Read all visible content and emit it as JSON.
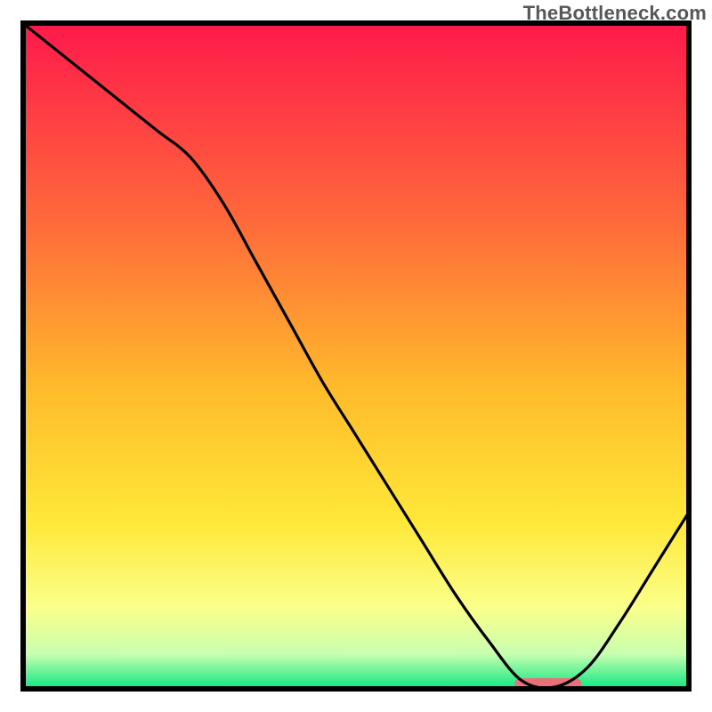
{
  "watermark": "TheBottleneck.com",
  "chart_data": {
    "type": "line",
    "title": "",
    "xlabel": "",
    "ylabel": "",
    "xlim": [
      0,
      100
    ],
    "ylim": [
      0,
      100
    ],
    "grid": false,
    "legend": false,
    "background_gradient": {
      "stops": [
        {
          "offset": 0.0,
          "color": "#ff1a4b"
        },
        {
          "offset": 0.3,
          "color": "#ff6a3a"
        },
        {
          "offset": 0.55,
          "color": "#ffbb2b"
        },
        {
          "offset": 0.75,
          "color": "#ffe838"
        },
        {
          "offset": 0.88,
          "color": "#fbff8a"
        },
        {
          "offset": 0.95,
          "color": "#c8ffb0"
        },
        {
          "offset": 1.0,
          "color": "#17e884"
        }
      ]
    },
    "marker_band": {
      "x_start": 74,
      "x_end": 84,
      "y": 0,
      "color": "#e8707b"
    },
    "x": [
      0,
      5,
      10,
      15,
      20,
      25,
      30,
      35,
      40,
      45,
      50,
      55,
      60,
      65,
      70,
      75,
      80,
      85,
      90,
      95,
      100
    ],
    "series": [
      {
        "name": "curve",
        "values": [
          100,
          96,
          92,
          88,
          84,
          80,
          73,
          64,
          55,
          46,
          38,
          30,
          22,
          14,
          7,
          1,
          0,
          3,
          10,
          18,
          26
        ]
      }
    ],
    "note": "Values read off pixel positions; axes unlabeled in source image, so x and y are normalized 0–100."
  },
  "colors": {
    "frame": "#000000",
    "curve": "#000000",
    "marker": "#e8707b"
  }
}
